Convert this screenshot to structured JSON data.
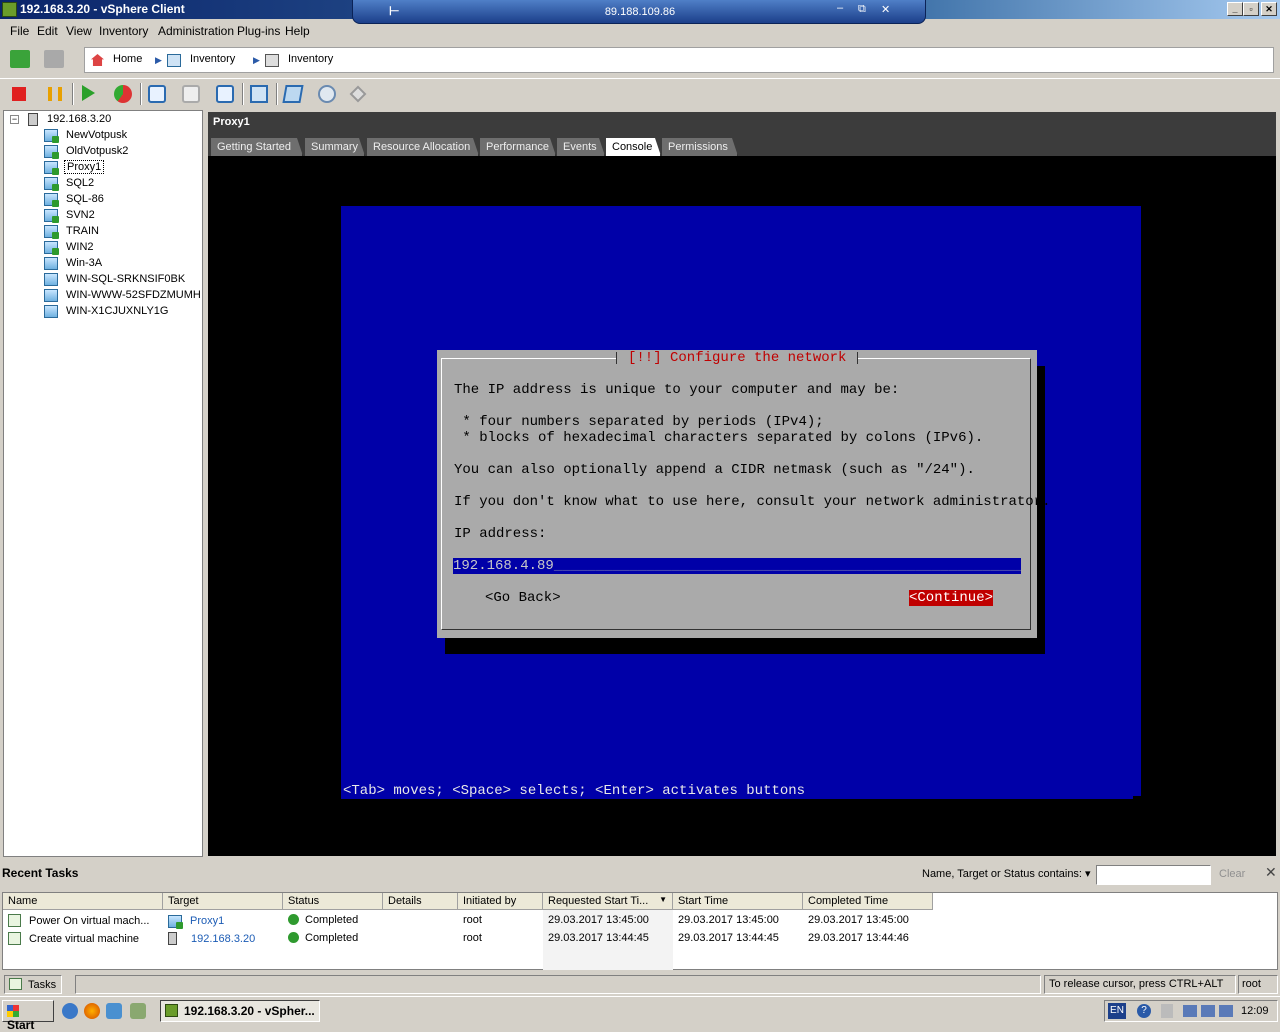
{
  "window": {
    "title": "192.168.3.20 - vSphere Client"
  },
  "rdp": {
    "host": "89.188.109.86",
    "pin": "⊢",
    "min": "–",
    "restore": "⧉",
    "close": "✕"
  },
  "menu": [
    "File",
    "Edit",
    "View",
    "Inventory",
    "Administration",
    "Plug-ins",
    "Help"
  ],
  "breadcrumb": {
    "home": "Home",
    "inventory1": "Inventory",
    "inventory2": "Inventory"
  },
  "tree": {
    "host": "192.168.3.20",
    "vms": [
      "NewVotpusk",
      "OldVotpusk2",
      "Proxy1",
      "SQL2",
      "SQL-86",
      "SVN2",
      "TRAIN",
      "WIN2",
      "Win-3A",
      "WIN-SQL-SRKNSIF0BK",
      "WIN-WWW-52SFDZMUMH",
      "WIN-X1CJUXNLY1G"
    ],
    "selected": "Proxy1"
  },
  "vm_header": "Proxy1",
  "tabs": [
    "Getting Started",
    "Summary",
    "Resource Allocation",
    "Performance",
    "Events",
    "Console",
    "Permissions"
  ],
  "active_tab": "Console",
  "installer": {
    "title": "[!!] Configure the network",
    "lines": [
      "The IP address is unique to your computer and may be:",
      "",
      " * four numbers separated by periods (IPv4);",
      " * blocks of hexadecimal characters separated by colons (IPv6).",
      "",
      "You can also optionally append a CIDR netmask (such as \"/24\").",
      "",
      "If you don't know what to use here, consult your network administrator.",
      "",
      "IP address:"
    ],
    "ip_value": "192.168.4.89",
    "go_back": "<Go Back>",
    "continue": "<Continue>",
    "footer": "<Tab> moves; <Space> selects; <Enter> activates buttons"
  },
  "recent_tasks": {
    "title": "Recent Tasks",
    "filter_label": "Name, Target or Status contains: ▾",
    "filter_value": "",
    "clear": "Clear",
    "close": "✕",
    "columns": [
      "Name",
      "Target",
      "Status",
      "Details",
      "Initiated by",
      "Requested Start Ti... ",
      "Start Time",
      "Completed Time"
    ],
    "rows": [
      {
        "name": "Power On virtual mach...",
        "target": "Proxy1",
        "status": "Completed",
        "details": "",
        "initiated_by": "root",
        "requested": "29.03.2017 13:45:00",
        "start": "29.03.2017 13:45:00",
        "completed": "29.03.2017 13:45:00"
      },
      {
        "name": "Create virtual machine",
        "target": "192.168.3.20",
        "status": "Completed",
        "details": "",
        "initiated_by": "root",
        "requested": "29.03.2017 13:44:45",
        "start": "29.03.2017 13:44:45",
        "completed": "29.03.2017 13:44:46"
      }
    ]
  },
  "status": {
    "tasks": "Tasks",
    "message": "To release cursor, press CTRL+ALT",
    "user": "root"
  },
  "taskbar": {
    "start": "Start",
    "task": "192.168.3.20 - vSpher...",
    "lang": "EN",
    "clock": "12:09"
  }
}
